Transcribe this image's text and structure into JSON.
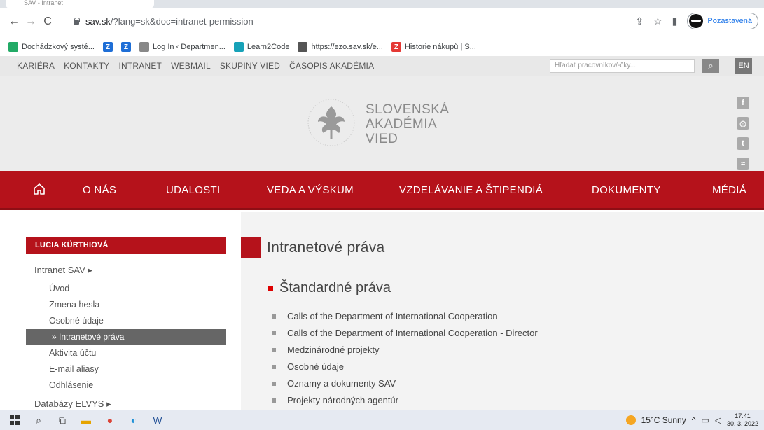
{
  "browser": {
    "tab_title": "SAV - Intranet",
    "url_domain": "sav.sk",
    "url_path": "/?lang=sk&doc=intranet-permission",
    "profile_label": "Pozastavená"
  },
  "bookmarks": [
    {
      "label": "Dochádzkový systé...",
      "color": "#2a6"
    },
    {
      "label": "",
      "color": "#1e6ed6",
      "glyph": "Z"
    },
    {
      "label": "",
      "color": "#1e6ed6",
      "glyph": "Z"
    },
    {
      "label": "Log In ‹ Departmen...",
      "color": "#888"
    },
    {
      "label": "Learn2Code",
      "color": "#17a2b8"
    },
    {
      "label": "https://ezo.sav.sk/e...",
      "color": "#555"
    },
    {
      "label": "Historie nákupů | S...",
      "color": "#e53935",
      "glyph": "Z"
    }
  ],
  "utility_links": [
    "KARIÉRA",
    "KONTAKTY",
    "INTRANET",
    "WEBMAIL",
    "SKUPINY VIED",
    "ČASOPIS AKADÉMIA"
  ],
  "search_placeholder": "Hľadať pracovníkov/-čky...",
  "lang_button": "EN",
  "logo_lines": [
    "SLOVENSKÁ",
    "AKADÉMIA",
    "VIED"
  ],
  "main_nav": [
    "O NÁS",
    "UDALOSTI",
    "VEDA A VÝSKUM",
    "VZDELÁVANIE A ŠTIPENDIÁ",
    "DOKUMENTY",
    "MÉDIÁ"
  ],
  "sidebar": {
    "user": "LUCIA KÜRTHIOVÁ",
    "group1": "Intranet SAV ▸",
    "items": [
      "Úvod",
      "Zmena hesla",
      "Osobné údaje",
      "» Intranetové práva",
      "Aktivita účtu",
      "E-mail aliasy",
      "Odhlásenie"
    ],
    "group2": "Databázy ELVYS ▸"
  },
  "page_title": "Intranetové práva",
  "section_title": "Štandardné práva",
  "rights": [
    "Calls of the Department of International Cooperation",
    "Calls of the Department of International Cooperation - Director",
    "Medzinárodné projekty",
    "Osobné údaje",
    "Oznamy a dokumenty SAV",
    "Projekty národných agentúr"
  ],
  "taskbar": {
    "weather": "15°C Sunny",
    "time": "17:41",
    "date": "30. 3. 2022"
  },
  "colors": {
    "brand_red": "#b5121b"
  }
}
